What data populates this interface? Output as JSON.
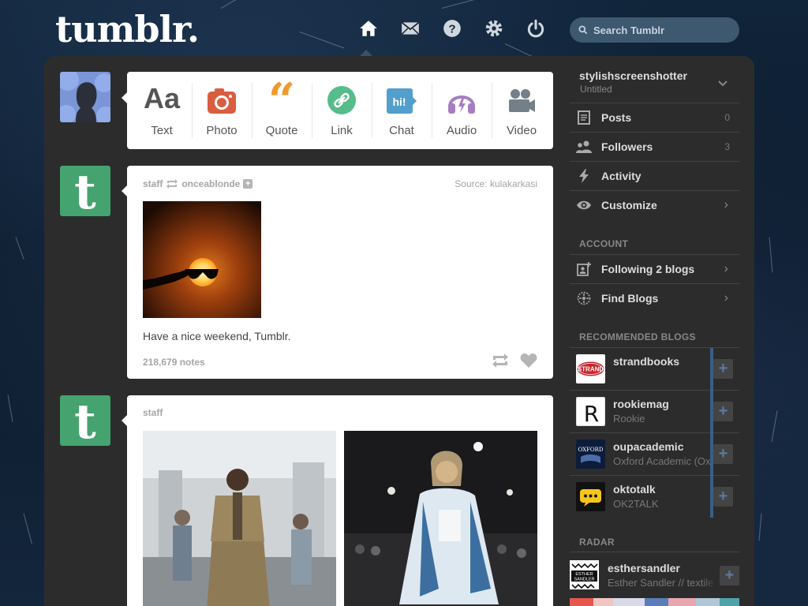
{
  "header": {
    "logo": "tumblr.",
    "search_placeholder": "Search Tumblr",
    "nav": [
      "home-icon",
      "mail-icon",
      "help-icon",
      "gear-icon",
      "power-icon"
    ]
  },
  "post_types": [
    {
      "label": "Text",
      "icon": "text-icon",
      "color": "#555555"
    },
    {
      "label": "Photo",
      "icon": "camera-icon",
      "color": "#d95e40"
    },
    {
      "label": "Quote",
      "icon": "quote-icon",
      "color": "#f2992e"
    },
    {
      "label": "Link",
      "icon": "link-icon",
      "color": "#56bc8a"
    },
    {
      "label": "Chat",
      "icon": "chat-icon",
      "color": "#529ecc"
    },
    {
      "label": "Audio",
      "icon": "headphones-icon",
      "color": "#a77dc2"
    },
    {
      "label": "Video",
      "icon": "video-icon",
      "color": "#748089"
    }
  ],
  "post1": {
    "author": "staff",
    "reblogged_from": "onceablonde",
    "source_label": "Source:",
    "source": "kulakarkasi",
    "caption": "Have a nice weekend, Tumblr.",
    "notes": "218,679 notes"
  },
  "post2": {
    "author": "staff"
  },
  "sidebar": {
    "blog_name": "stylishscreenshotter",
    "blog_title": "Untitled",
    "items": [
      {
        "label": "Posts",
        "count": "0",
        "icon": "posts-icon"
      },
      {
        "label": "Followers",
        "count": "3",
        "icon": "followers-icon"
      },
      {
        "label": "Activity",
        "icon": "lightning-icon"
      },
      {
        "label": "Customize",
        "icon": "eye-icon"
      }
    ],
    "account_label": "ACCOUNT",
    "account_items": [
      {
        "label": "Following 2 blogs",
        "icon": "following-icon"
      },
      {
        "label": "Find Blogs",
        "icon": "find-blogs-icon"
      }
    ],
    "recommended_label": "RECOMMENDED BLOGS",
    "recommended": [
      {
        "name": "strandbooks",
        "subtitle": "",
        "avatar_text": "STRAND"
      },
      {
        "name": "rookiemag",
        "subtitle": "Rookie",
        "avatar_text": "R"
      },
      {
        "name": "oupacademic",
        "subtitle": "Oxford Academic (Ox",
        "avatar_text": "OXFORD"
      },
      {
        "name": "oktotalk",
        "subtitle": "OK2TALK",
        "avatar_text": "..."
      }
    ],
    "radar_label": "RADAR",
    "radar": {
      "name": "esthersandler",
      "subtitle": "Esther Sandler // textile",
      "avatar_text": "ESTHER SANDLER"
    }
  }
}
